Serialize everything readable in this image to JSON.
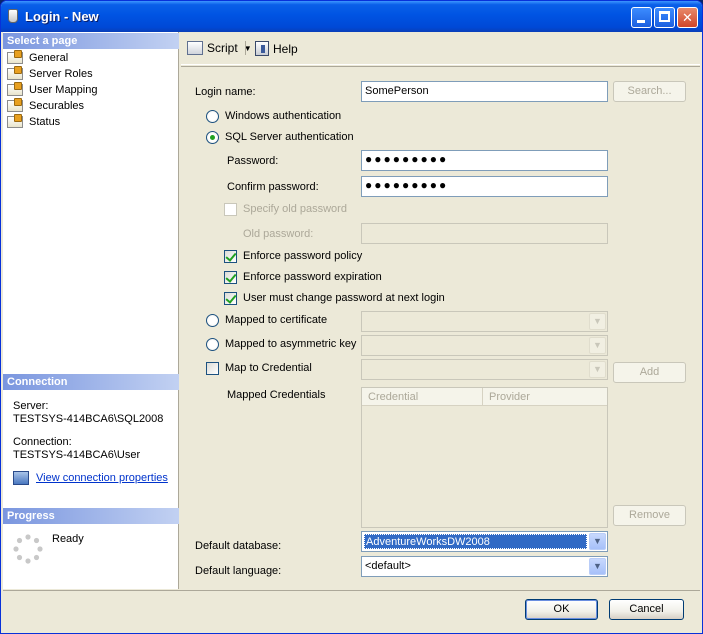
{
  "window": {
    "title": "Login - New"
  },
  "sidebar": {
    "select_page_header": "Select a page",
    "pages": [
      {
        "label": "General"
      },
      {
        "label": "Server Roles"
      },
      {
        "label": "User Mapping"
      },
      {
        "label": "Securables"
      },
      {
        "label": "Status"
      }
    ],
    "connection_header": "Connection",
    "server_label": "Server:",
    "server_value": "TESTSYS-414BCA6\\SQL2008",
    "connection_label": "Connection:",
    "connection_value": "TESTSYS-414BCA6\\User",
    "view_connection_link": "View connection properties",
    "progress_header": "Progress",
    "progress_status": "Ready"
  },
  "toolbar": {
    "script_label": "Script",
    "help_label": "Help"
  },
  "form": {
    "login_name_label": "Login name:",
    "login_name_value": "SomePerson",
    "search_button": "Search...",
    "windows_auth": "Windows authentication",
    "sql_auth": "SQL Server authentication",
    "password_label": "Password:",
    "password_value": "●●●●●●●●●",
    "confirm_password_label": "Confirm password:",
    "confirm_password_value": "●●●●●●●●●",
    "specify_old_password": "Specify old password",
    "old_password_label": "Old password:",
    "old_password_value": "",
    "enforce_policy": "Enforce password policy",
    "enforce_expiration": "Enforce password expiration",
    "must_change": "User must change password at next login",
    "mapped_certificate": "Mapped to certificate",
    "mapped_asymmetric_key": "Mapped to asymmetric key",
    "map_to_credential": "Map to Credential",
    "add_button": "Add",
    "mapped_credentials_label": "Mapped Credentials",
    "credentials_columns": [
      "Credential",
      "Provider"
    ],
    "remove_button": "Remove",
    "default_database_label": "Default database:",
    "default_database_value": "AdventureWorksDW2008",
    "default_language_label": "Default language:",
    "default_language_value": "<default>"
  },
  "footer": {
    "ok_button": "OK",
    "cancel_button": "Cancel"
  },
  "colors": {
    "title_bar": "#0054e3",
    "section_header": "#7a96df",
    "link": "#0033cc",
    "check_mark": "#21a121",
    "selection": "#316ac5"
  }
}
